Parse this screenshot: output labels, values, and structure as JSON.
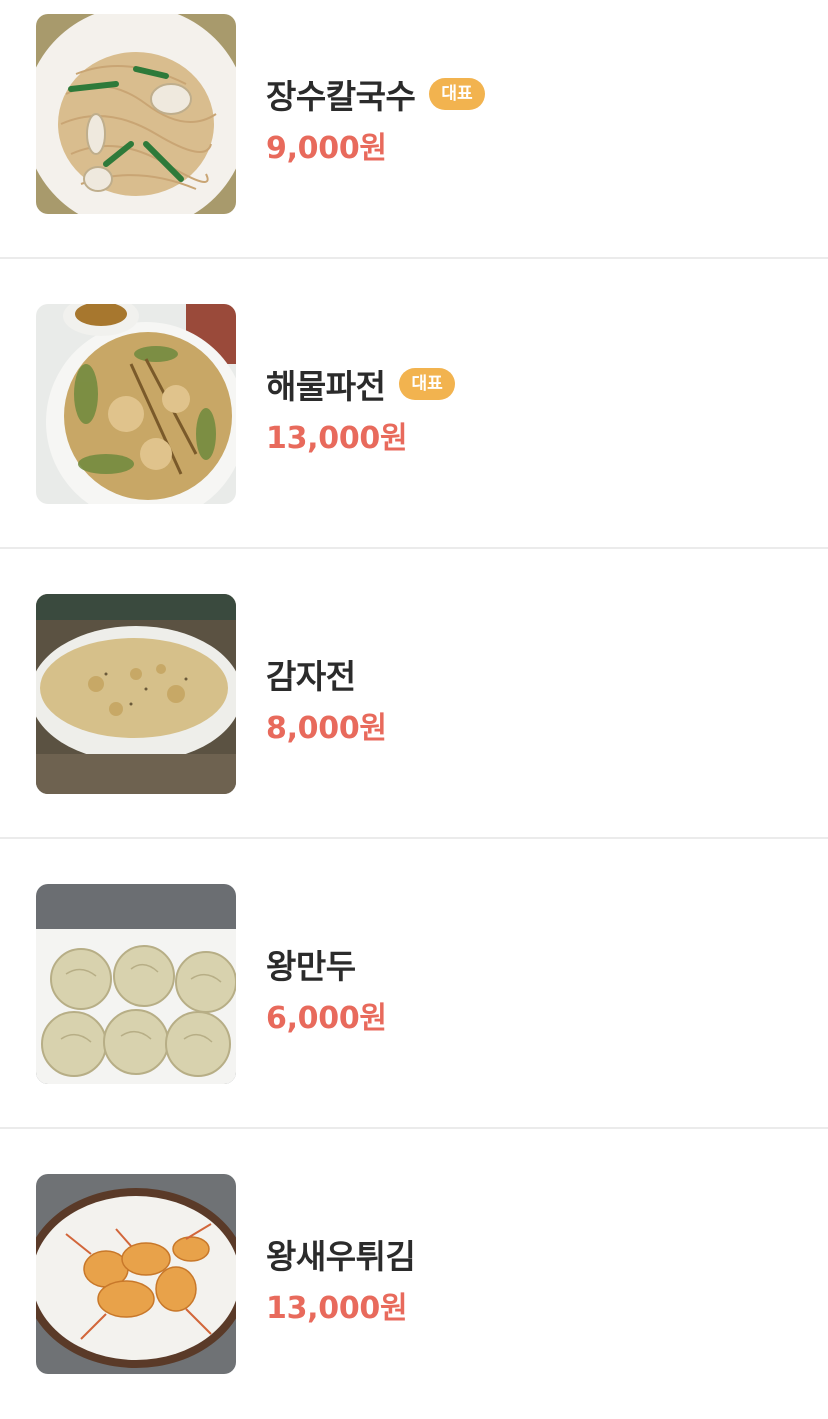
{
  "menu": {
    "items": [
      {
        "name": "장수칼국수",
        "badge": "대표",
        "price": "9,000원",
        "image": "noodle-dish-photo"
      },
      {
        "name": "해물파전",
        "badge": "대표",
        "price": "13,000원",
        "image": "seafood-pancake-photo"
      },
      {
        "name": "감자전",
        "badge": "",
        "price": "8,000원",
        "image": "potato-pancake-photo"
      },
      {
        "name": "왕만두",
        "badge": "",
        "price": "6,000원",
        "image": "dumplings-photo"
      },
      {
        "name": "왕새우튀김",
        "badge": "",
        "price": "13,000원",
        "image": "fried-shrimp-photo"
      }
    ]
  },
  "colors": {
    "name_text": "#2b2b2b",
    "price_text": "#e86a5c",
    "badge_bg": "#f2b34f",
    "divider": "#ebebeb"
  }
}
